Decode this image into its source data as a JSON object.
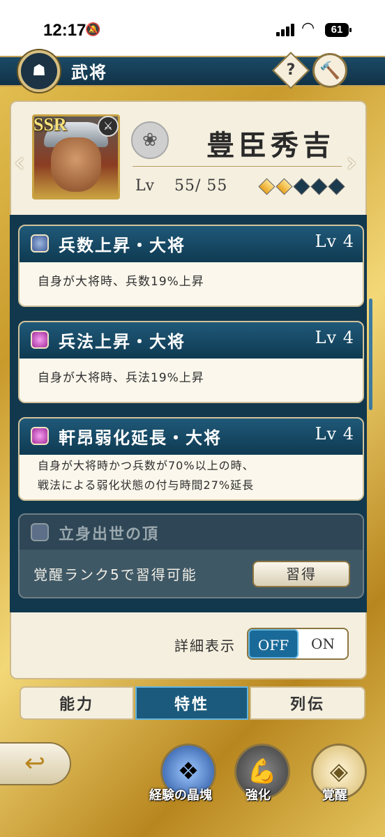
{
  "status_bar": {
    "time": "12:17",
    "battery": "61"
  },
  "header": {
    "title": "武将",
    "help_label": "?"
  },
  "general": {
    "rarity": "SSR",
    "name": "豊臣秀吉",
    "level_label": "Lv",
    "level_value": "55/ 55",
    "awakening_total": 5,
    "awakening_filled": 2
  },
  "traits": [
    {
      "title": "兵数上昇・大将",
      "lv": "Lv 4",
      "icon_color": "blue",
      "desc": [
        "自身が大将時、兵数19%上昇"
      ]
    },
    {
      "title": "兵法上昇・大将",
      "lv": "Lv 4",
      "icon_color": "purple",
      "desc": [
        "自身が大将時、兵法19%上昇"
      ]
    },
    {
      "title": "軒昂弱化延長・大将",
      "lv": "Lv 4",
      "icon_color": "purple",
      "desc": [
        "自身が大将時かつ兵数が70%以上の時、",
        "戦法による弱化状態の付与時間27%延長"
      ]
    }
  ],
  "locked_trait": {
    "title": "立身出世の頂",
    "desc": "覚醒ランク5で習得可能",
    "button": "習得"
  },
  "detail_toggle": {
    "label": "詳細表示",
    "off": "OFF",
    "on": "ON",
    "selected": "OFF"
  },
  "tabs": [
    {
      "label": "能力",
      "active": false
    },
    {
      "label": "特性",
      "active": true
    },
    {
      "label": "列伝",
      "active": false
    }
  ],
  "bottom_nav": [
    {
      "label": "経験の晶塊",
      "icon": "crystal-icon"
    },
    {
      "label": "強化",
      "icon": "muscle-icon"
    },
    {
      "label": "覚醒",
      "icon": "diamond-icon"
    }
  ],
  "colors": {
    "accent_blue": "#1b5a7c",
    "gold": "#c99a2c",
    "panel": "#f5efdf"
  }
}
